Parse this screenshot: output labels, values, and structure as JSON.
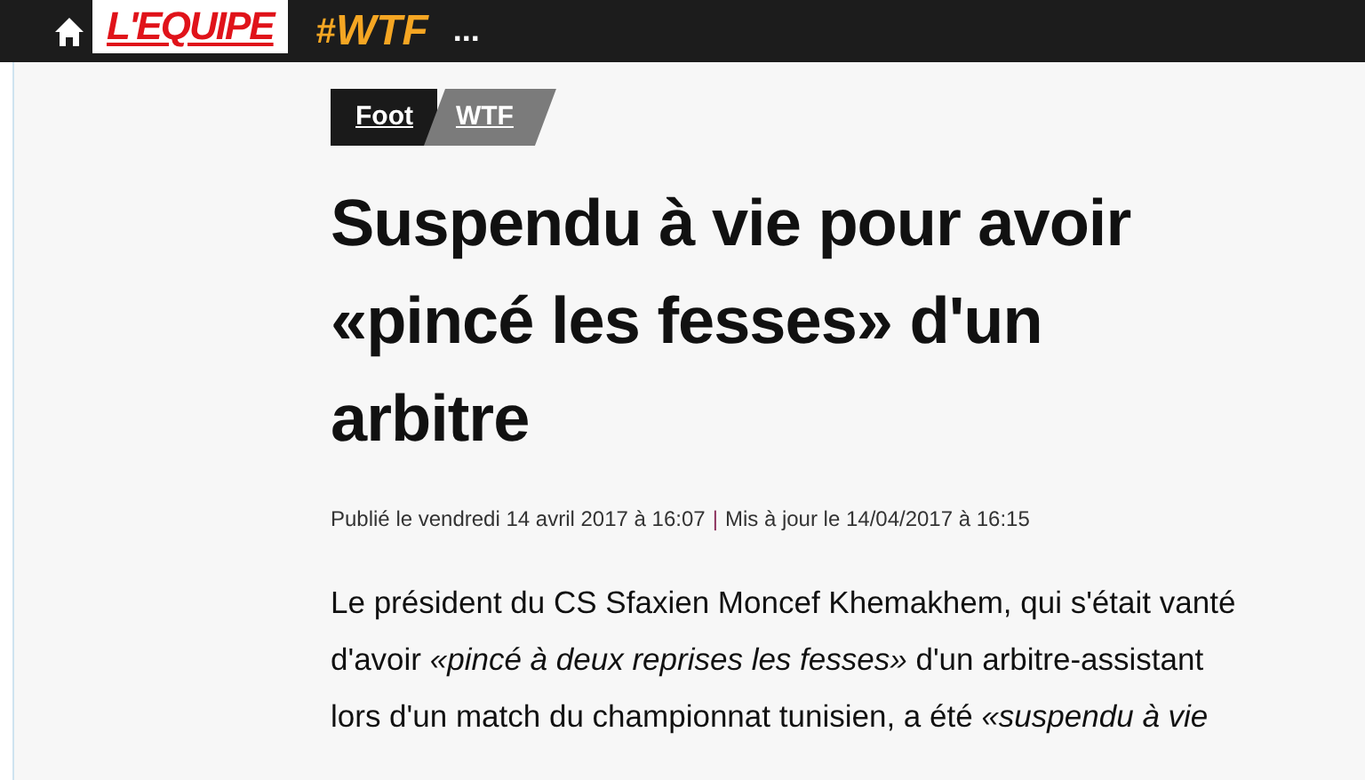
{
  "header": {
    "logo": "L'EQUIPE",
    "section": {
      "hash": "#",
      "name": "WTF"
    },
    "more": "..."
  },
  "tags": [
    {
      "label": "Foot",
      "kind": "primary"
    },
    {
      "label": "WTF",
      "kind": "secondary"
    }
  ],
  "article": {
    "title_lines": [
      "Suspendu à vie pour avoir",
      "«pincé les fesses» d'un",
      "arbitre"
    ],
    "published": "Publié le vendredi 14 avril 2017 à 16:07",
    "separator": "|",
    "updated": "Mis à jour le 14/04/2017 à 16:15",
    "body_lines": [
      "Le président du CS Sfaxien Moncef Khemakhem, qui s'était vanté",
      "d'avoir *«pincé à deux reprises les fesses»* d'un arbitre-assistant",
      "lors d'un match du championnat tunisien, a été *«suspendu à vie*"
    ]
  }
}
